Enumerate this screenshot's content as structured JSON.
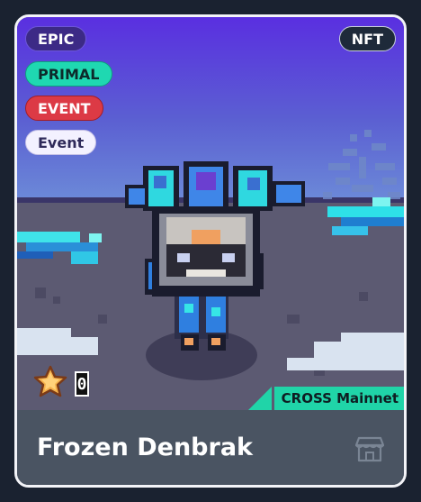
{
  "badges": {
    "rarity": "EPIC",
    "type": "PRIMAL",
    "category": "EVENT",
    "source": "Event",
    "token": "NFT"
  },
  "item": {
    "name": "Frozen Denbrak",
    "count": "0"
  },
  "network": {
    "label": "CROSS Mainnet"
  },
  "colors": {
    "epic": "#3c2a86",
    "primal": "#1fd8b1",
    "event": "#dc3a45",
    "network": "#20d4a8",
    "footer": "#4a5462",
    "sky_top": "#5a2fe0",
    "ground": "#5c5a72"
  },
  "icons": {
    "star": "star-icon",
    "shop": "storefront-icon"
  }
}
